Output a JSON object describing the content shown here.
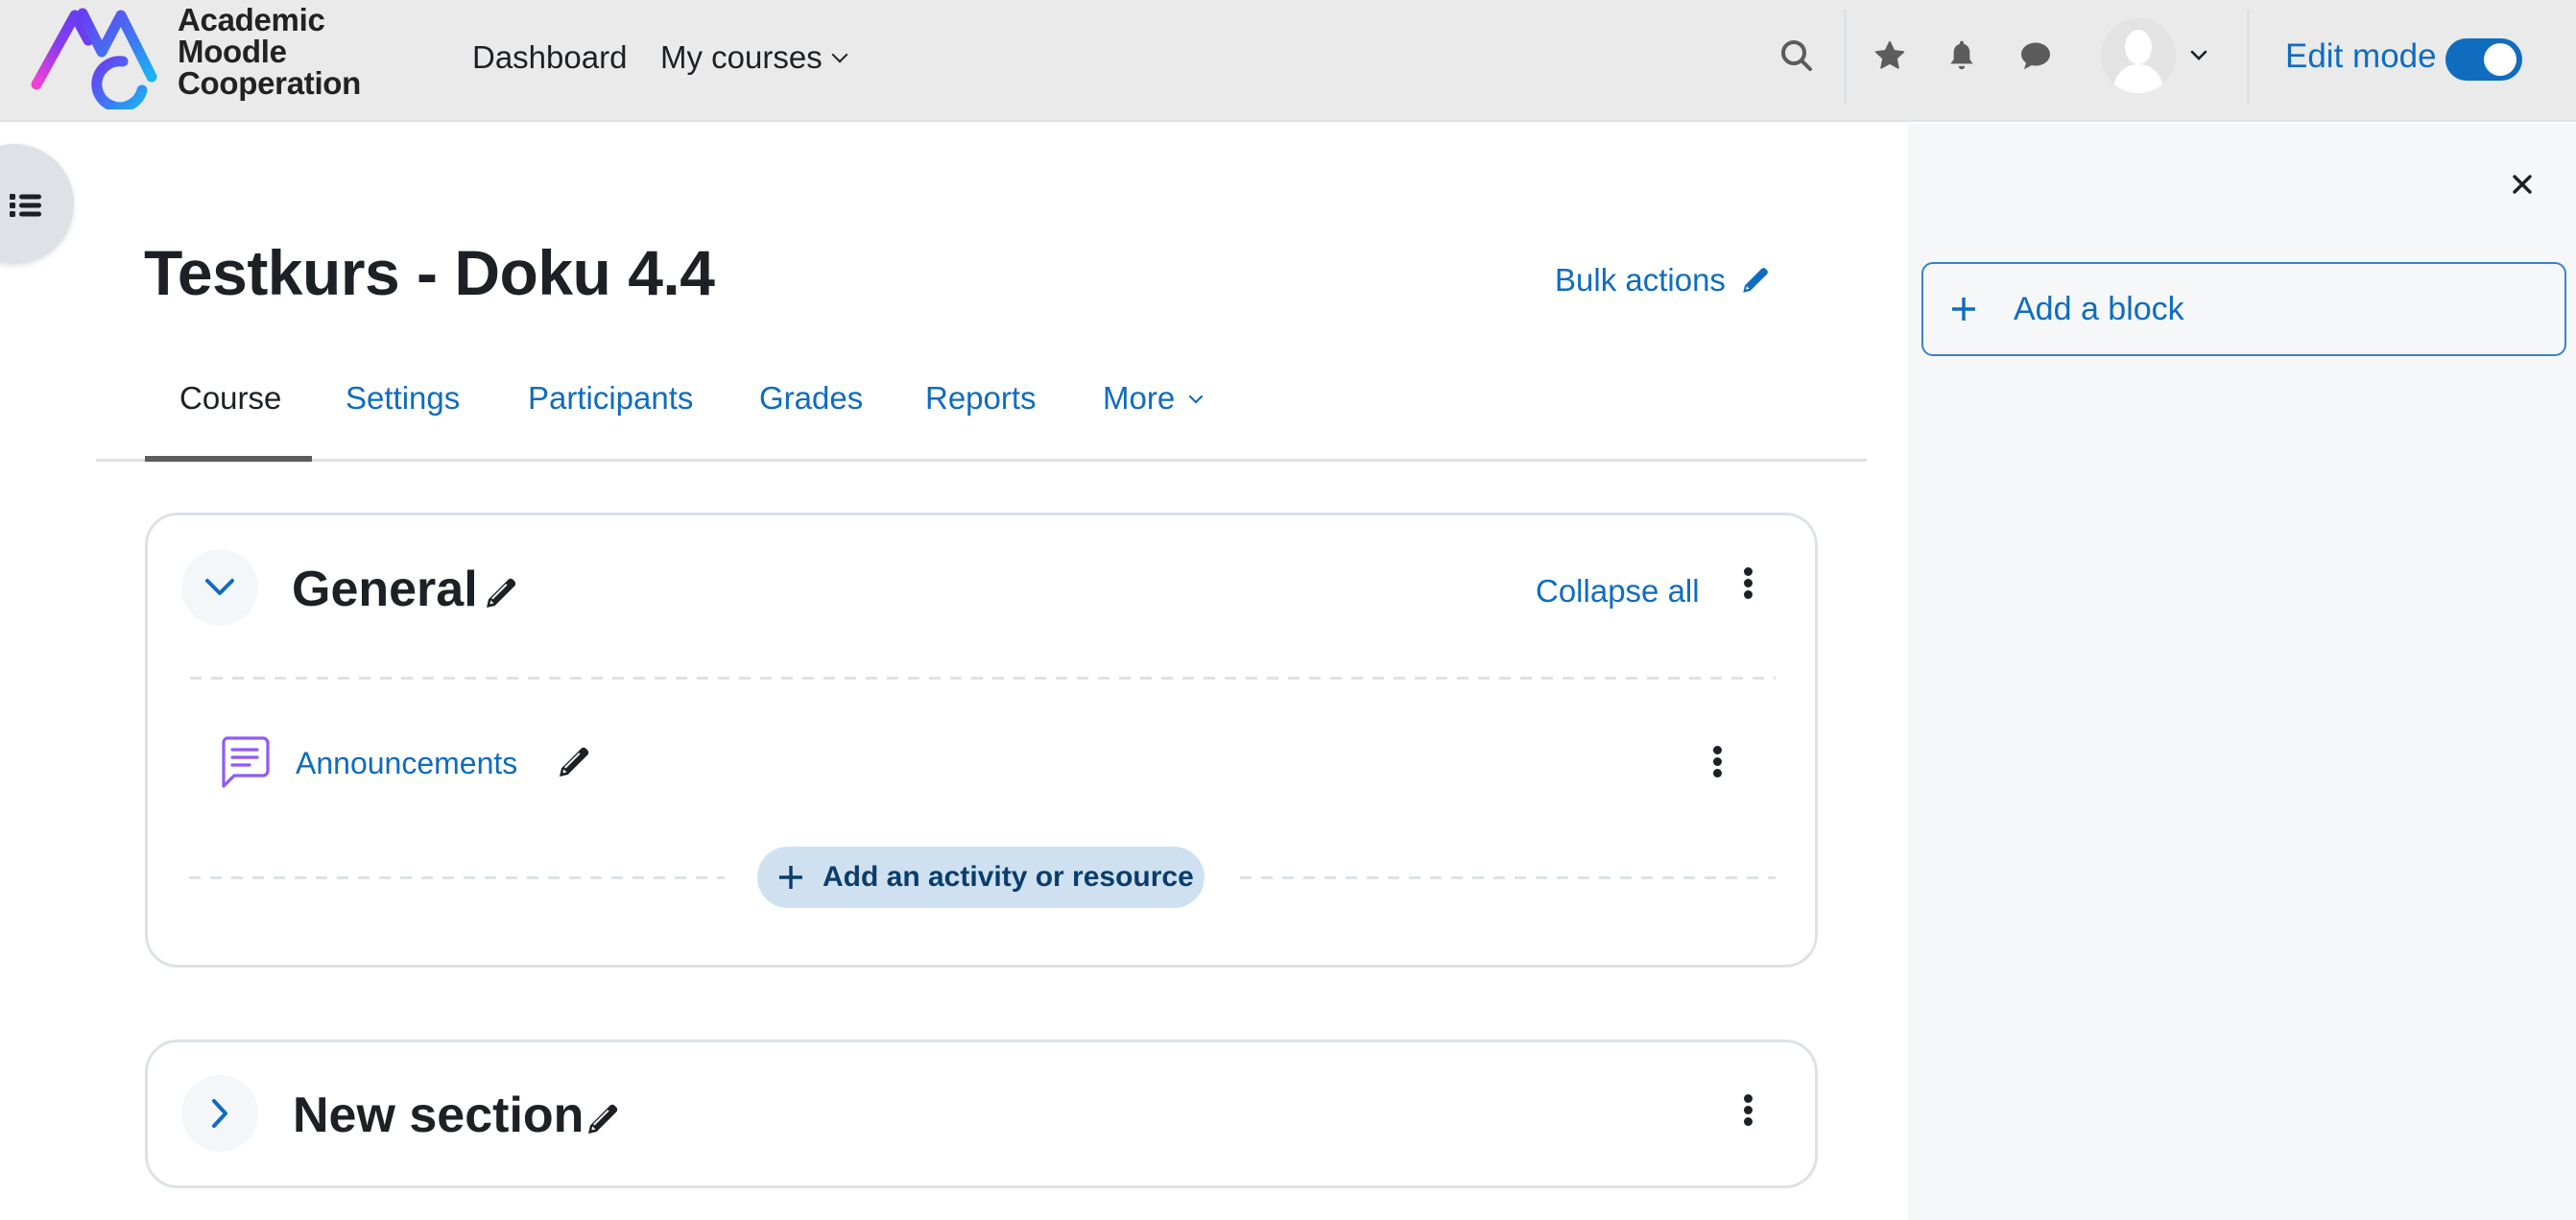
{
  "header": {
    "logo": {
      "alt": "Academic Moodle Cooperation",
      "lines": [
        "Academic",
        "Moodle",
        "Cooperation"
      ],
      "gradient": [
        "#e942d9",
        "#7a3cf2",
        "#1aa8f0"
      ]
    },
    "nav": [
      {
        "label": "Dashboard",
        "has_dropdown": false
      },
      {
        "label": "My courses",
        "has_dropdown": true
      }
    ],
    "icons": [
      "search-icon",
      "star-icon",
      "bell-icon",
      "chat-icon"
    ],
    "user_menu": {
      "avatar": "default-user-avatar",
      "has_dropdown": true
    },
    "edit_mode": {
      "label": "Edit mode",
      "enabled": true
    }
  },
  "left_drawer": {
    "toggle_icon": "list-icon",
    "open": false
  },
  "page": {
    "title": "Testkurs - Doku 4.4",
    "bulk_actions_label": "Bulk actions",
    "tabs": [
      {
        "label": "Course",
        "active": true
      },
      {
        "label": "Settings",
        "active": false
      },
      {
        "label": "Participants",
        "active": false
      },
      {
        "label": "Grades",
        "active": false
      },
      {
        "label": "Reports",
        "active": false
      },
      {
        "label": "More",
        "active": false,
        "has_dropdown": true
      }
    ]
  },
  "sections": [
    {
      "title": "General",
      "expanded": true,
      "collapse_all_label": "Collapse all",
      "activities": [
        {
          "name": "Announcements",
          "type": "forum",
          "icon": "forum-icon",
          "icon_color": "#8f59f6"
        }
      ],
      "add_activity_label": "Add an activity or resource"
    },
    {
      "title": "New section",
      "expanded": false
    }
  ],
  "right_drawer": {
    "open": true,
    "add_block_label": "Add a block"
  },
  "colors": {
    "primary": "#0f6cbf",
    "text": "#1d2125",
    "header_bg": "#eaeaea",
    "drawer_bg": "#f5f7f9",
    "add_activity_bg": "#cfe1f1",
    "add_activity_text": "#0a3d6b"
  }
}
